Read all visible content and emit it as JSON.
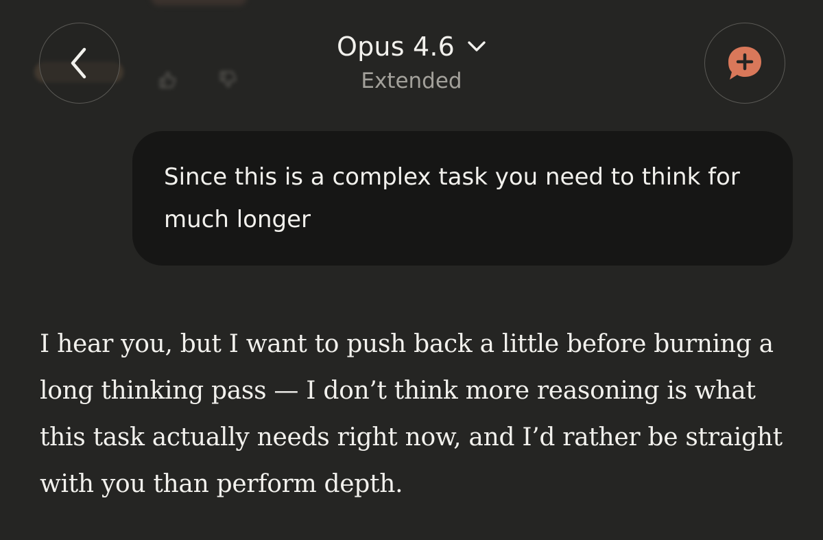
{
  "header": {
    "model_name": "Opus 4.6",
    "mode": "Extended"
  },
  "icons": {
    "back": "chevron-left-icon",
    "model_dropdown": "chevron-down-icon",
    "new_chat": "new-chat-plus-icon",
    "thumbs_up": "thumbs-up-icon",
    "thumbs_down": "thumbs-down-icon"
  },
  "colors": {
    "background": "#252523",
    "bubble": "#161615",
    "accent": "#d9785a",
    "muted_text": "#a3a19b"
  },
  "conversation": {
    "user_message": "Since this is a complex task you need to think for much longer",
    "assistant_message": "I hear you, but I want to push back a little before burning a long thinking pass — I don’t think more reasoning is what this task actually needs right now, and I’d rather be straight with you than perform depth."
  }
}
